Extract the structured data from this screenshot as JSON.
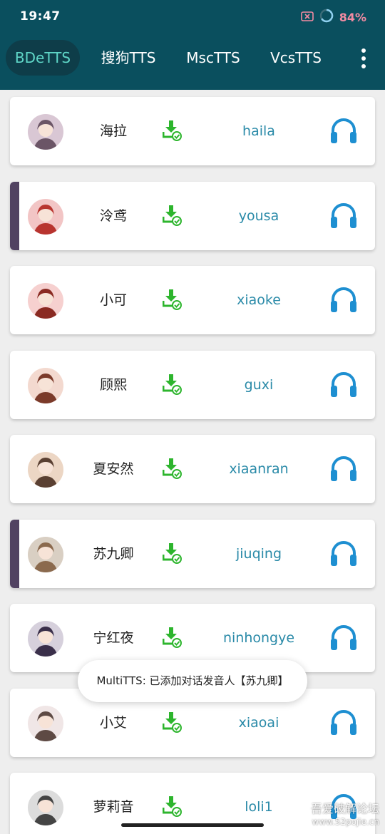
{
  "status": {
    "time": "19:47",
    "battery": "84%"
  },
  "tabs": [
    {
      "label": "BDeTTS",
      "active": true
    },
    {
      "label": "搜狗TTS",
      "active": false
    },
    {
      "label": "MscTTS",
      "active": false
    },
    {
      "label": "VcsTTS",
      "active": false
    }
  ],
  "voices": [
    {
      "name": "海拉",
      "id": "haila",
      "selected": false
    },
    {
      "name": "泠鸢",
      "id": "yousa",
      "selected": true
    },
    {
      "name": "小可",
      "id": "xiaoke",
      "selected": false
    },
    {
      "name": "顾熙",
      "id": "guxi",
      "selected": false
    },
    {
      "name": "夏安然",
      "id": "xiaanran",
      "selected": false
    },
    {
      "name": "苏九卿",
      "id": "jiuqing",
      "selected": true
    },
    {
      "name": "宁红夜",
      "id": "ninhongye",
      "selected": false
    },
    {
      "name": "小艾",
      "id": "xiaoai",
      "selected": false
    },
    {
      "name": "萝莉音",
      "id": "loli1",
      "selected": false
    }
  ],
  "icons": {
    "download": "download-icon",
    "headphones": "headphones-icon",
    "menu": "more-vert-icon"
  },
  "colors": {
    "header": "#0a4f5e",
    "active_tab_text": "#5fd6c7",
    "voice_id": "#2a8aa8",
    "download": "#2db52d",
    "headphones": "#1e8fd1",
    "selected_bar": "#514261"
  },
  "toast": {
    "message": "MultiTTS: 已添加对话发音人【苏九卿】"
  },
  "watermark": {
    "title": "吾爱破解论坛",
    "url": "www.52pojie.cn"
  }
}
